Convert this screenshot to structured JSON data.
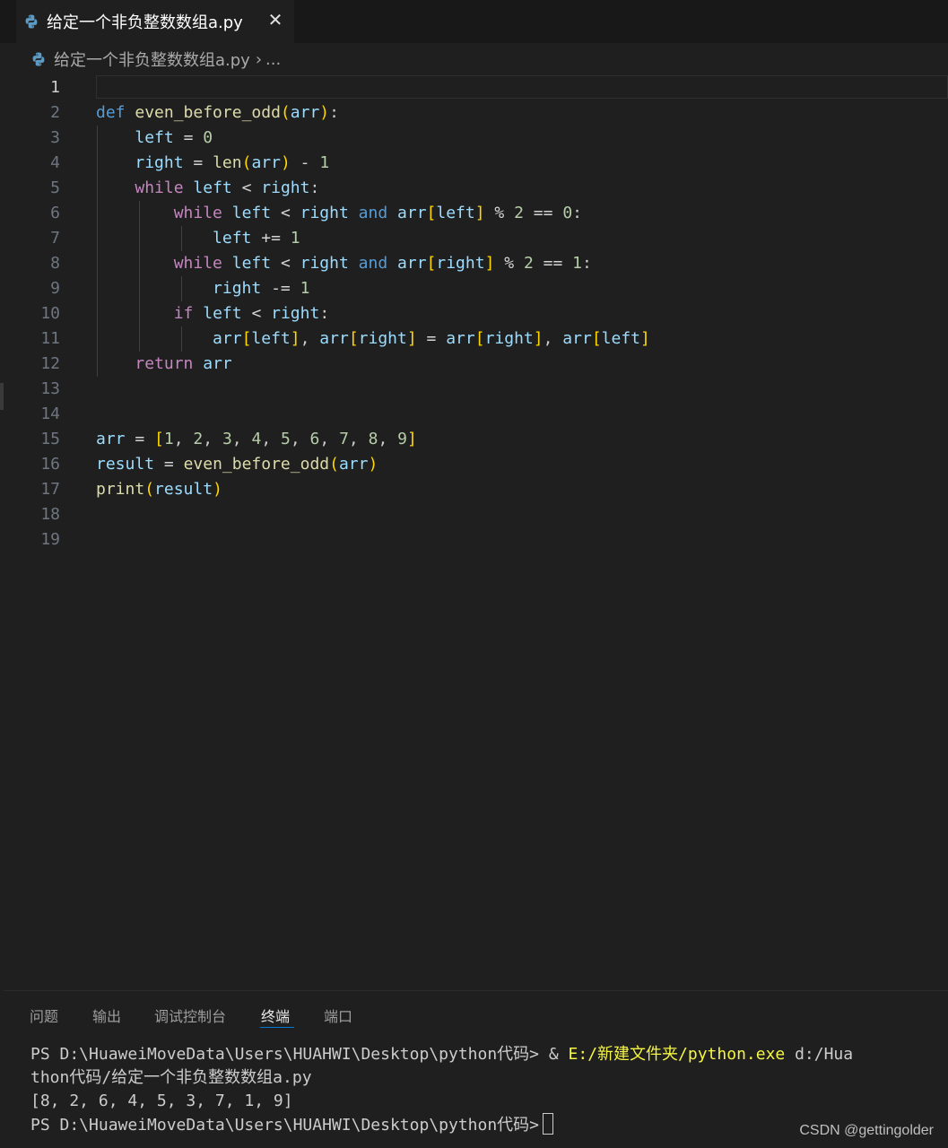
{
  "tab": {
    "title": "给定一个非负整数数组a.py",
    "close_glyph": "✕"
  },
  "breadcrumb": {
    "file": "给定一个非负整数数组a.py",
    "separator": "›",
    "more": "..."
  },
  "editor": {
    "line_numbers": [
      "1",
      "2",
      "3",
      "4",
      "5",
      "6",
      "7",
      "8",
      "9",
      "10",
      "11",
      "12",
      "13",
      "14",
      "15",
      "16",
      "17",
      "18",
      "19"
    ],
    "active_line": "1"
  },
  "panel": {
    "tabs": [
      "问题",
      "输出",
      "调试控制台",
      "终端",
      "端口"
    ],
    "active_tab": "终端"
  },
  "terminal": {
    "prompt1": "PS D:\\HuaweiMoveData\\Users\\HUAHWI\\Desktop\\python代码> & ",
    "exe": "E:/新建文件夹/python.exe",
    "arg": " d:/Hua",
    "line2": "thon代码/给定一个非负整数数组a.py",
    "output": "[8, 2, 6, 4, 5, 3, 7, 1, 9]",
    "prompt2": "PS D:\\HuaweiMoveData\\Users\\HUAHWI\\Desktop\\python代码>"
  },
  "watermark": "CSDN @gettingolder",
  "colors": {
    "editor_bg": "#1f1f1f",
    "tabbar_bg": "#181818",
    "keyword": "#569cd6",
    "control": "#c586c0",
    "function": "#dcdcaa",
    "variable": "#9cdcfe",
    "number": "#b5cea8",
    "accent": "#0078d4"
  },
  "icons": {
    "file_icon": "python-icon"
  }
}
